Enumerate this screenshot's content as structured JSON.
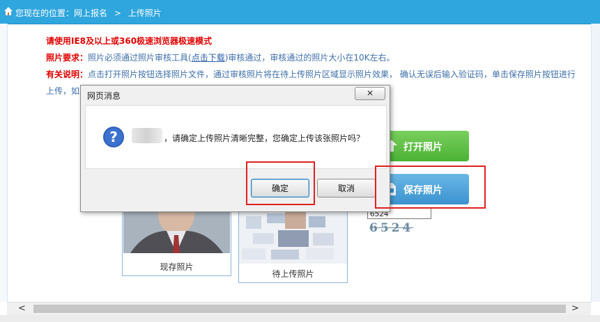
{
  "breadcrumb": {
    "prefix": "您现在的位置：网上报名",
    "separator": ">",
    "current": "上传照片"
  },
  "notice": {
    "browser_tip": "请使用IE8及以上或360极速浏览器极速模式",
    "photo_req_label": "照片要求：",
    "photo_req_text_before": "照片必须通过照片审核工具(",
    "photo_req_link": "点击下载",
    "photo_req_text_after": ")审核通过，审核通过的照片大小在10K左右。",
    "explain_label": "有关说明：",
    "explain_text": "点击打开照片按钮选择照片文件，通过审核照片将在待上传照片区域显示照片效果， 确认无误后输入验证码，单击保存照片按钮进行上传，如上传过程中遇到问题请通过照片审核工具重新审核后再进行照片上传操作。"
  },
  "buttons": {
    "open_photo": "打开照片",
    "save_photo": "保存照片"
  },
  "photos": {
    "current_label": "现存照片",
    "pending_label": "待上传照片"
  },
  "captcha": {
    "input_value": "6524",
    "image_text": "6524"
  },
  "dialog": {
    "title": "网页消息",
    "close": "✕",
    "message": "，请确定上传照片清晰完整，您确定上传该张照片吗？",
    "ok": "确定",
    "cancel": "取消"
  },
  "scrollbar": {
    "left": "<",
    "right": ">"
  },
  "colors": {
    "header": "#2fa6dd",
    "accent_red": "#e00000",
    "open_green": "#4bb235",
    "save_blue": "#3b93cf",
    "highlight": "#e02020"
  }
}
